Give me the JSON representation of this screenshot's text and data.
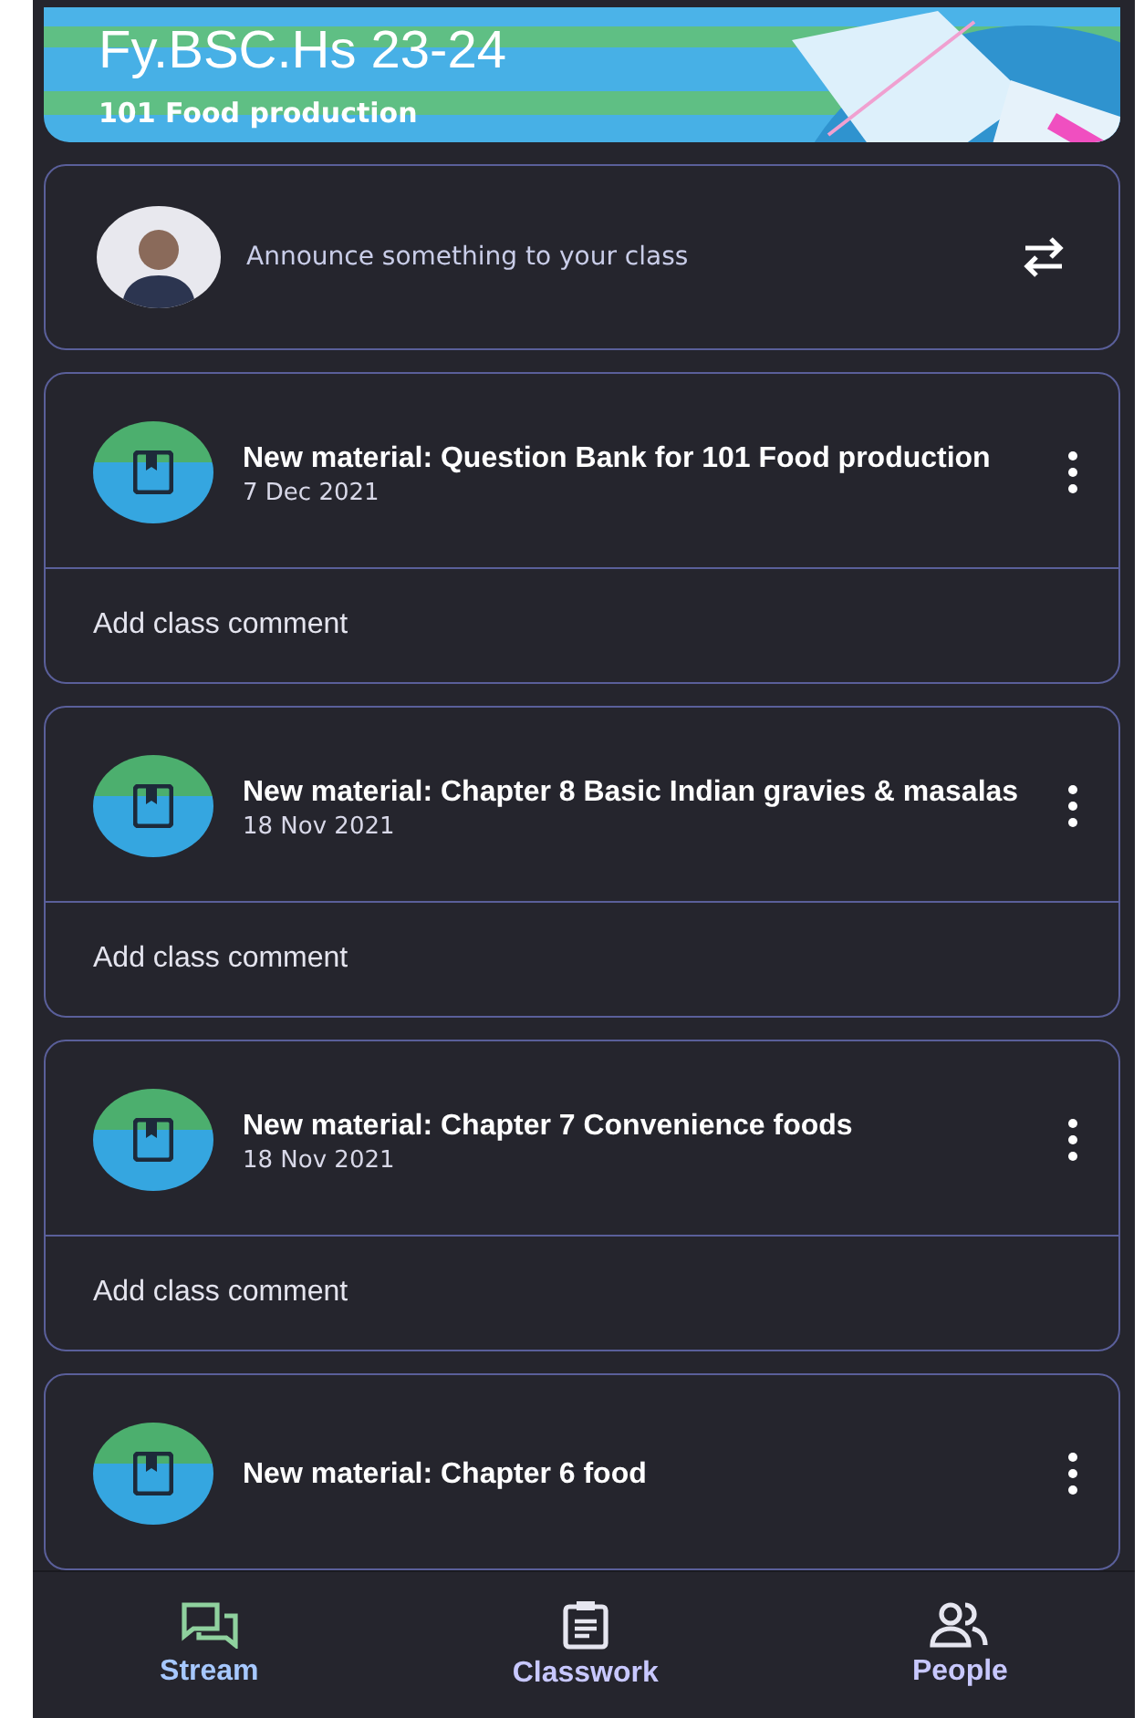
{
  "class_banner": {
    "title": "Fy.BSC.Hs 23-24",
    "subtitle": "101 Food production"
  },
  "announce": {
    "placeholder": "Announce something to your class"
  },
  "posts": [
    {
      "title": "New material: Question Bank for 101 Food production",
      "date": "7 Dec 2021",
      "comment": "Add class comment"
    },
    {
      "title": "New material: Chapter 8 Basic Indian gravies & masalas",
      "date": "18 Nov 2021",
      "comment": "Add class comment"
    },
    {
      "title": "New material: Chapter  7 Convenience foods",
      "date": "18 Nov 2021",
      "comment": "Add class comment"
    },
    {
      "title": "New material: Chapter  6 food"
    }
  ],
  "bottom_nav": [
    {
      "label": "Stream",
      "kind": "stream",
      "selected": true
    },
    {
      "label": "Classwork",
      "kind": "classwork",
      "selected": false
    },
    {
      "label": "People",
      "kind": "people",
      "selected": false
    }
  ]
}
